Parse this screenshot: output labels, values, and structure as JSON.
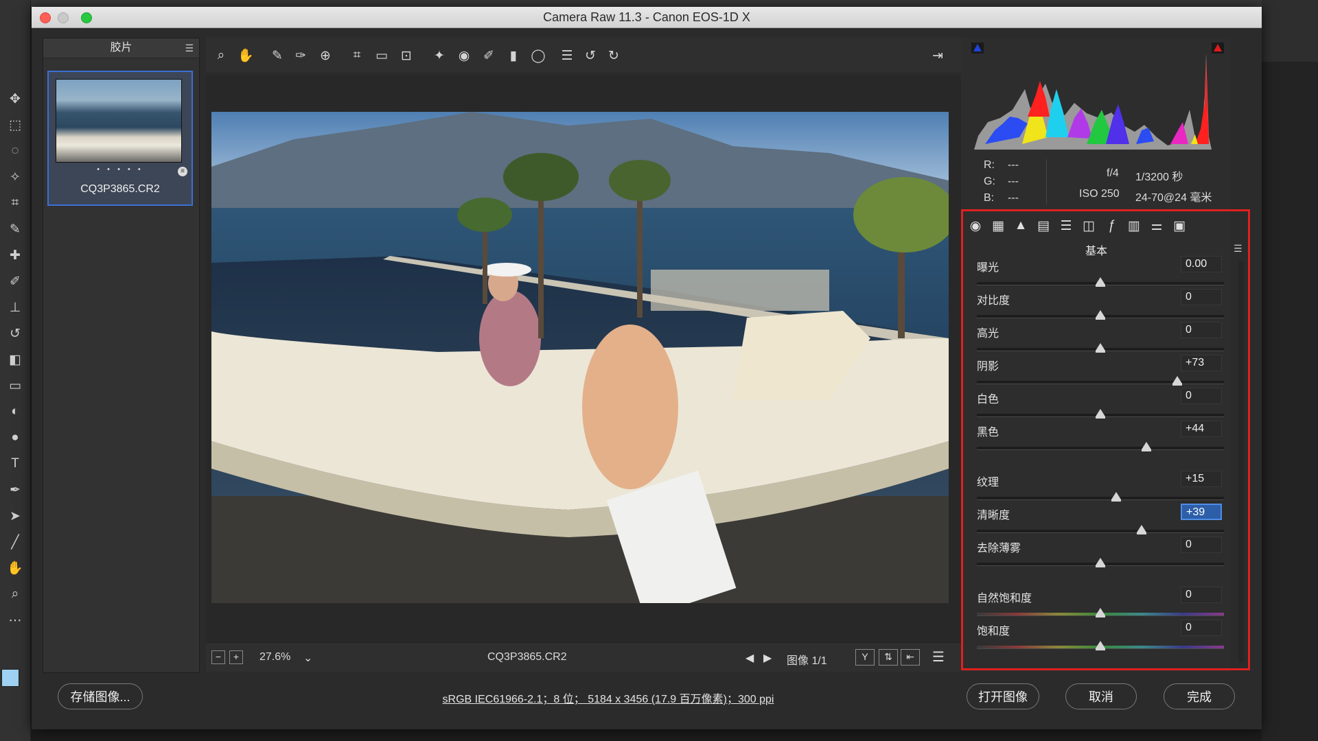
{
  "dialog_title": "Camera Raw 11.3 -  Canon EOS-1D X",
  "filmstrip": {
    "header": "胶片",
    "thumb_dots": "• • • • •",
    "thumb_name": "CQ3P3865.CR2"
  },
  "status_bar": {
    "zoom": "27.6%",
    "filename": "CQ3P3865.CR2",
    "image_count": "图像 1/1"
  },
  "metadata": {
    "r_label": "R:",
    "r_value": "---",
    "g_label": "G:",
    "g_value": "---",
    "b_label": "B:",
    "b_value": "---",
    "aperture": "f/4",
    "shutter": "1/3200 秒",
    "iso": "ISO 250",
    "lens": "24-70@24 毫米"
  },
  "panel": {
    "title": "基本",
    "sliders": [
      {
        "label": "曝光",
        "value": "0.00",
        "level": 0.0,
        "active": false
      },
      {
        "label": "对比度",
        "value": "0",
        "level": 0,
        "active": false
      },
      {
        "label": "高光",
        "value": "0",
        "level": 0,
        "active": false
      },
      {
        "label": "阴影",
        "value": "+73",
        "level": 73,
        "active": false
      },
      {
        "label": "白色",
        "value": "0",
        "level": 0,
        "active": false
      },
      {
        "label": "黑色",
        "value": "+44",
        "level": 44,
        "active": false
      },
      {
        "label": "纹理",
        "value": "+15",
        "level": 15,
        "active": false
      },
      {
        "label": "清晰度",
        "value": "+39",
        "level": 39,
        "active": true
      },
      {
        "label": "去除薄雾",
        "value": "0",
        "level": 0,
        "active": false
      },
      {
        "label": "自然饱和度",
        "value": "0",
        "level": 0,
        "active": false
      },
      {
        "label": "饱和度",
        "value": "0",
        "level": 0,
        "active": false
      }
    ]
  },
  "footer": {
    "save_button": "存储图像...",
    "info": "sRGB IEC61966-2.1；8 位； 5184 x 3456 (17.9 百万像素)；300 ppi",
    "open_button": "打开图像",
    "cancel_button": "取消",
    "done_button": "完成"
  },
  "colors": {
    "accent_blue": "#3b6fd6",
    "highlight_red": "#e0201f",
    "active_field": "#2d5ea8"
  }
}
